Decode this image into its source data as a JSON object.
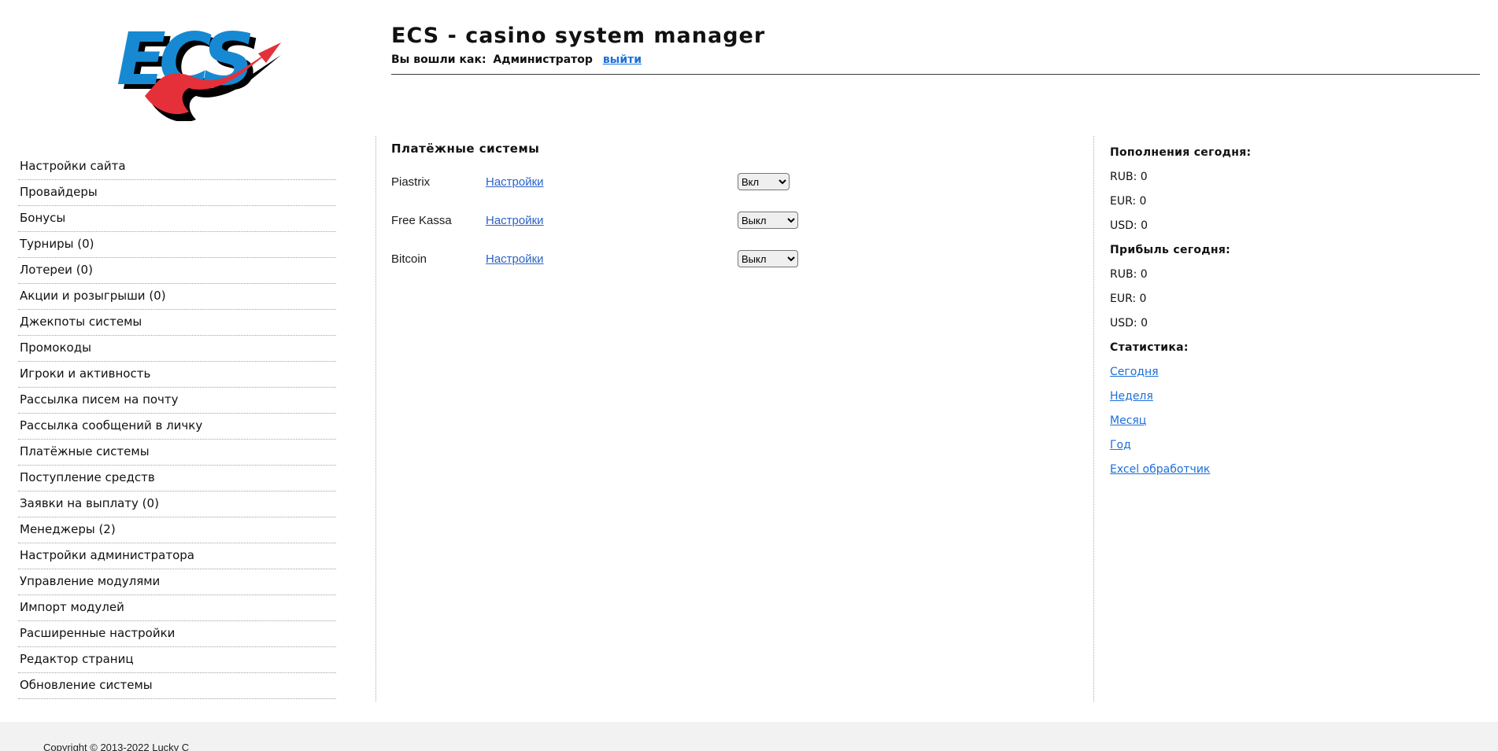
{
  "header": {
    "logo_text": "ECS",
    "title": "ECS - casino system manager",
    "login_prefix": "Вы вошли как:",
    "login_user": "Администратор",
    "logout_label": "выйти"
  },
  "sidebar": {
    "items": [
      "Настройки сайта",
      "Провайдеры",
      "Бонусы",
      "Турниры (0)",
      "Лотереи (0)",
      "Акции и розыгрыши (0)",
      "Джекпоты системы",
      "Промокоды",
      "Игроки и активность",
      "Рассылка писем на почту",
      "Рассылка сообщений в личку",
      "Платёжные системы",
      "Поступление средств",
      "Заявки на выплату (0)",
      "Менеджеры (2)",
      "Настройки администратора",
      "Управление модулями",
      "Импорт модулей",
      "Расширенные настройки",
      "Редактор страниц",
      "Обновление системы"
    ]
  },
  "main": {
    "title": "Платёжные системы",
    "rows": [
      {
        "name": "Piastrix",
        "settings_label": "Настройки",
        "state": "Вкл"
      },
      {
        "name": "Free Kassa",
        "settings_label": "Настройки",
        "state": "Выкл"
      },
      {
        "name": "Bitcoin",
        "settings_label": "Настройки",
        "state": "Выкл"
      }
    ]
  },
  "stats": {
    "deposits_title": "Пополнения сегодня:",
    "deposits": {
      "rub": "RUB: 0",
      "eur": "EUR: 0",
      "usd": "USD: 0"
    },
    "profit_title": "Прибыль сегодня:",
    "profit": {
      "rub": "RUB: 0",
      "eur": "EUR: 0",
      "usd": "USD: 0"
    },
    "statistics_title": "Статистика:",
    "links": [
      "Сегодня",
      "Неделя",
      "Месяц",
      "Год",
      "Excel обработчик"
    ]
  },
  "footer": {
    "copyright": "Copyright © 2013-2022 Lucky C"
  },
  "colors": {
    "logo_blue": "#1689D2",
    "logo_red": "#E5303A",
    "link_blue": "#1B6FD8",
    "settings_link_blue": "#2B62C8",
    "footer_bg": "#F2F2F2"
  }
}
